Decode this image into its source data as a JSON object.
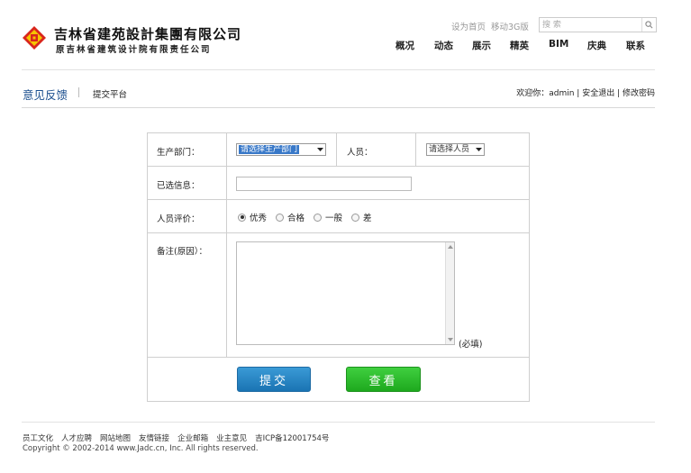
{
  "header": {
    "company_name": "吉林省建苑設計集團有限公司",
    "company_former_name": "原吉林省建筑设计院有限责任公司",
    "top_links": [
      "设为首页",
      "移动3G版"
    ],
    "search_placeholder": "搜 索",
    "nav": [
      "概况",
      "动态",
      "展示",
      "精英",
      "BIM",
      "庆典",
      "联系"
    ]
  },
  "subheader": {
    "title": "意见反馈",
    "subtitle": "提交平台",
    "welcome": "欢迎你：",
    "username": "admin",
    "logout": "安全退出",
    "change_password": "修改密码"
  },
  "form": {
    "dept_label": "生产部门：",
    "dept_value": "请选择生产部门",
    "person_label": "人员：",
    "person_value": "请选择人员",
    "selected_label": "已选信息：",
    "selected_value": "",
    "rating_label": "人员评价：",
    "rating_options": [
      "优秀",
      "合格",
      "一般",
      "差"
    ],
    "rating_selected": "优秀",
    "remark_label": "备注(原因）：",
    "remark_value": "",
    "required_note": "(必填)",
    "submit_label": "提交",
    "view_label": "查看"
  },
  "footer": {
    "links": [
      "员工文化",
      "人才应聘",
      "网站地图",
      "友情链接",
      "企业邮箱",
      "业主意见",
      "吉ICP备12001754号"
    ],
    "copyright": "Copyright © 2002-2014 www.Jadc.cn, Inc. All rights reserved."
  },
  "colors": {
    "logo_red": "#d9261c",
    "logo_yellow": "#f5c400",
    "section_title": "#1a4e8e",
    "submit_button": "#2283c4",
    "view_button": "#27b927"
  }
}
